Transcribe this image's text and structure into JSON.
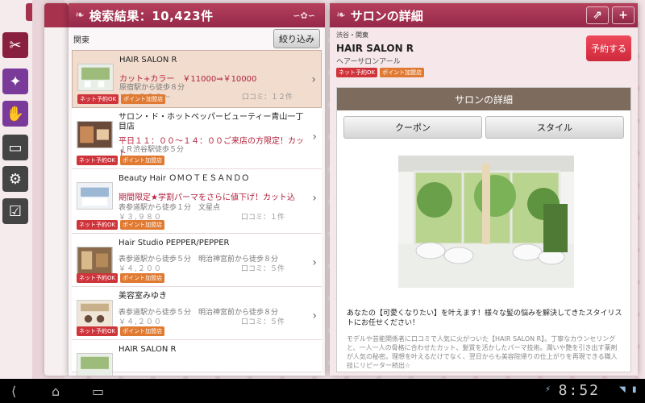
{
  "results": {
    "title": "検索結果：10,423件",
    "area": "関東",
    "filter_label": "絞り込み",
    "items": [
      {
        "name": "HAIR SALON R",
        "promo": "カット+カラー　￥11000⇒￥10000",
        "station": "原宿駅から徒歩８分",
        "price": "￥５,２５０～",
        "review": "口コミ：１２件",
        "badge_net": "ネット予約OK",
        "badge_pt": "ポイント加盟店"
      },
      {
        "name": "サロン・ド・ホットペッパービューティー青山一丁目店",
        "promo": "平日１１：００～１４：００ご来店の方限定！カット",
        "station": "ＪＲ渋谷駅徒歩５分",
        "price": "￥２,８００",
        "review": "",
        "badge_net": "ネット予約OK",
        "badge_pt": "ポイント加盟店"
      },
      {
        "name": "Beauty Hair ＯＭＯＴＥＳＡＮＤＯ",
        "promo": "期間限定★学割パーマをさらに値下げ！カット込",
        "station": "表参道駅から徒歩１分　文星点",
        "price": "￥３,９８０",
        "review": "口コミ：１件",
        "badge_net": "ネット予約OK",
        "badge_pt": "ポイント加盟店"
      },
      {
        "name": "Hair Studio PEPPER/PEPPER",
        "promo": "",
        "station": "表参道駅から徒歩５分　明治神宮前から徒歩８分",
        "price": "￥４,２００",
        "review": "口コミ：５件",
        "badge_net": "ネット予約OK",
        "badge_pt": "ポイント加盟店"
      },
      {
        "name": "美容室みゆき",
        "promo": "",
        "station": "表参道駅から徒歩５分　明治神宮前から徒歩８分",
        "price": "￥４,２００",
        "review": "口コミ：５件",
        "badge_net": "ネット予約OK",
        "badge_pt": "ポイント加盟店"
      },
      {
        "name": "HAIR SALON R",
        "promo": "",
        "station": "",
        "price": "",
        "review": "",
        "badge_net": "",
        "badge_pt": ""
      }
    ]
  },
  "detail": {
    "title": "サロンの詳細",
    "share_icon": "share-icon",
    "add_icon": "+",
    "area": "渋谷・関東",
    "salon_name": "HAIR SALON R",
    "salon_kana": "ヘアーサロンアール",
    "badge_net": "ネット予約OK",
    "badge_pt": "ポイント加盟店",
    "reserve_label": "予約する",
    "card_title": "サロンの詳細",
    "coupon_label": "クーポン",
    "style_label": "スタイル",
    "lead_text": "あなたの【可愛くなりたい】を叶えます！様々な髪の悩みを解決してきたスタイリストにお任せください！",
    "body_text": "モデルや芸能関係者に口コミで人気に火がついた【HAIR SALON R】。丁寧なカウンセリングと、一人一人の骨格に合わせたカット、髪質を活かしたパーマ技術。潤いや艶を引き出す薬剤が人気の秘密。理想を叶えるだけでなく、翌日からも美容院帰りの仕上がりを再現できる職人技にリピーター続出☆"
  },
  "system": {
    "time": "8:52"
  }
}
